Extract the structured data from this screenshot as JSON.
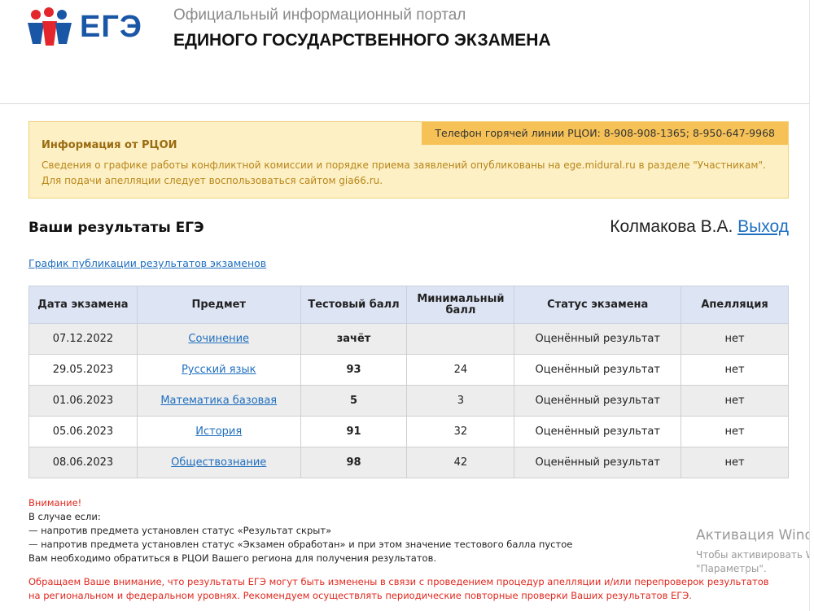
{
  "header": {
    "logo_text": "ЕГЭ",
    "portal_line1": "Официальный информационный портал",
    "portal_line2": "ЕДИНОГО ГОСУДАРСТВЕННОГО ЭКЗАМЕНА"
  },
  "info": {
    "hotline": "Телефон горячей линии РЦОИ: 8-908-908-1365; 8-950-647-9968",
    "title": "Информация от РЦОИ",
    "text1": "Сведения о графике работы конфликтной комиссии и порядке приема заявлений опубликованы на ege.midural.ru в разделе \"Участникам\".",
    "text2": "Для подачи апелляции следует воспользоваться сайтом gia66.ru."
  },
  "results": {
    "title": "Ваши результаты ЕГЭ",
    "user_name": "Колмакова В.А.",
    "logout": "Выход",
    "schedule_link": "График публикации результатов экзаменов",
    "columns": [
      "Дата экзамена",
      "Предмет",
      "Тестовый балл",
      "Минимальный балл",
      "Статус экзамена",
      "Апелляция"
    ],
    "rows": [
      {
        "date": "07.12.2022",
        "subject": "Сочинение",
        "score": "зачёт",
        "min": "",
        "status": "Оценённый результат",
        "appeal": "нет"
      },
      {
        "date": "29.05.2023",
        "subject": "Русский язык",
        "score": "93",
        "min": "24",
        "status": "Оценённый результат",
        "appeal": "нет"
      },
      {
        "date": "01.06.2023",
        "subject": "Математика базовая",
        "score": "5",
        "min": "3",
        "status": "Оценённый результат",
        "appeal": "нет"
      },
      {
        "date": "05.06.2023",
        "subject": "История",
        "score": "91",
        "min": "32",
        "status": "Оценённый результат",
        "appeal": "нет"
      },
      {
        "date": "08.06.2023",
        "subject": "Обществознание",
        "score": "98",
        "min": "42",
        "status": "Оценённый результат",
        "appeal": "нет"
      }
    ]
  },
  "notes": {
    "attention": "Внимание!",
    "line1": "В случае если:",
    "line2": "— напротив предмета установлен статус «Результат скрыт»",
    "line3": "— напротив предмета установлен статус «Экзамен обработан» и при этом значение тестового балла пустое",
    "line4": "Вам необходимо обратиться в РЦОИ Вашего региона для получения результатов.",
    "bottom1": "Обращаем Ваше внимание, что результаты ЕГЭ могут быть изменены в связи с проведением процедур апелляции и/или перепроверок результатов",
    "bottom2": "на региональном и федеральном уровнях. Рекомендуем осуществлять периодические повторные проверки Ваших результатов ЕГЭ."
  },
  "activation": {
    "title": "Активация Windows",
    "line1": "Чтобы активировать Windows, перейдите в раздел",
    "line2": "\"Параметры\"."
  }
}
